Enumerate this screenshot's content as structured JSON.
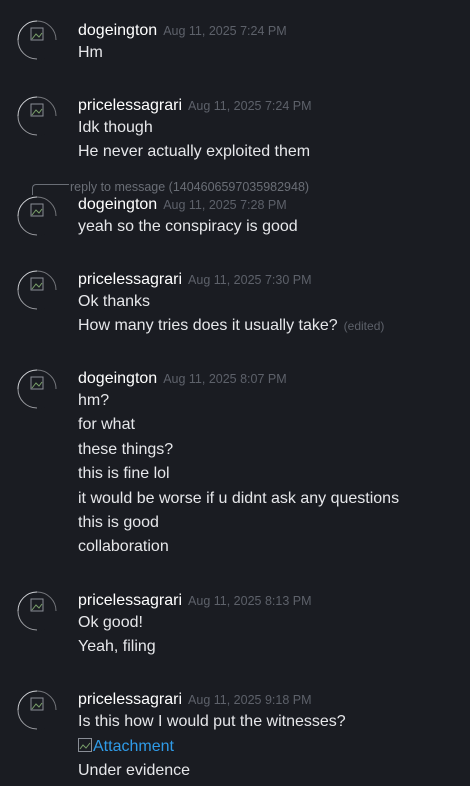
{
  "reply": {
    "text": "reply to message (1404606597035982948)"
  },
  "attachment_text": "Attachment",
  "groups": [
    {
      "author": "dogeington",
      "timestamp": "Aug 11, 2025 7:24 PM",
      "lines": [
        "Hm"
      ]
    },
    {
      "author": "pricelessagrari",
      "timestamp": "Aug 11, 2025 7:24 PM",
      "lines": [
        "Idk though",
        "He never actually exploited them"
      ]
    },
    {
      "author": "dogeington",
      "timestamp": "Aug 11, 2025 7:28 PM",
      "lines": [
        "yeah so the conspiracy is good"
      ]
    },
    {
      "author": "pricelessagrari",
      "timestamp": "Aug 11, 2025 7:30 PM",
      "lines": [
        "Ok thanks",
        "How many tries does it usually take?"
      ],
      "edited": "(edited)"
    },
    {
      "author": "dogeington",
      "timestamp": "Aug 11, 2025 8:07 PM",
      "lines": [
        "hm?",
        "for what",
        "these things?",
        "this is fine lol",
        "it would be worse if u didnt ask any questions",
        "this is good",
        "collaboration"
      ]
    },
    {
      "author": "pricelessagrari",
      "timestamp": "Aug 11, 2025 8:13 PM",
      "lines": [
        "Ok good!",
        "Yeah, filing"
      ]
    },
    {
      "author": "pricelessagrari",
      "timestamp": "Aug 11, 2025 9:18 PM",
      "lines": [
        "Is this how I would put the witnesses?",
        "Under evidence"
      ]
    }
  ],
  "colors": {
    "background": "#1a1c22",
    "link": "#2f9be8",
    "timestamp": "#5d616a"
  }
}
